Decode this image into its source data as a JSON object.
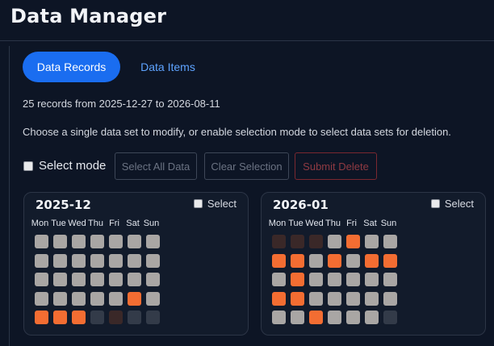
{
  "app": {
    "title": "Data Manager"
  },
  "tabs": [
    {
      "label": "Data Records",
      "active": true
    },
    {
      "label": "Data Items",
      "active": false
    }
  ],
  "summary": "25 records from 2025-12-27 to 2026-08-11",
  "instructions": "Choose a single data set to modify, or enable selection mode to select data sets for deletion.",
  "toolbar": {
    "select_mode_label": "Select mode",
    "select_all_label": "Select All Data",
    "clear_selection_label": "Clear Selection",
    "submit_delete_label": "Submit Delete"
  },
  "colors": {
    "accent": "#1a6df0",
    "record": "#f36d32",
    "empty_day": "#a9a6a4",
    "outside_month": "#333b49",
    "outside_month_alt": "#3a2828"
  },
  "weekdays": [
    "Mon",
    "Tue",
    "Wed",
    "Thu",
    "Fri",
    "Sat",
    "Sun"
  ],
  "months": [
    {
      "title": "2025-12",
      "select_label": "Select",
      "weeks": [
        [
          "gray",
          "gray",
          "gray",
          "gray",
          "gray",
          "gray",
          "gray"
        ],
        [
          "gray",
          "gray",
          "gray",
          "gray",
          "gray",
          "gray",
          "gray"
        ],
        [
          "gray",
          "gray",
          "gray",
          "gray",
          "gray",
          "gray",
          "gray"
        ],
        [
          "gray",
          "gray",
          "gray",
          "gray",
          "gray",
          "orange",
          "gray"
        ],
        [
          "orange",
          "orange",
          "orange",
          "slate",
          "brown",
          "slate",
          "slate"
        ]
      ]
    },
    {
      "title": "2026-01",
      "select_label": "Select",
      "weeks": [
        [
          "brown",
          "brown",
          "brown",
          "gray",
          "orange",
          "gray",
          "gray"
        ],
        [
          "orange",
          "orange",
          "gray",
          "orange",
          "gray",
          "orange",
          "orange"
        ],
        [
          "gray",
          "orange",
          "gray",
          "gray",
          "gray",
          "gray",
          "gray"
        ],
        [
          "orange",
          "orange",
          "gray",
          "gray",
          "gray",
          "gray",
          "gray"
        ],
        [
          "gray",
          "gray",
          "orange",
          "gray",
          "gray",
          "gray",
          "slate"
        ]
      ]
    }
  ]
}
